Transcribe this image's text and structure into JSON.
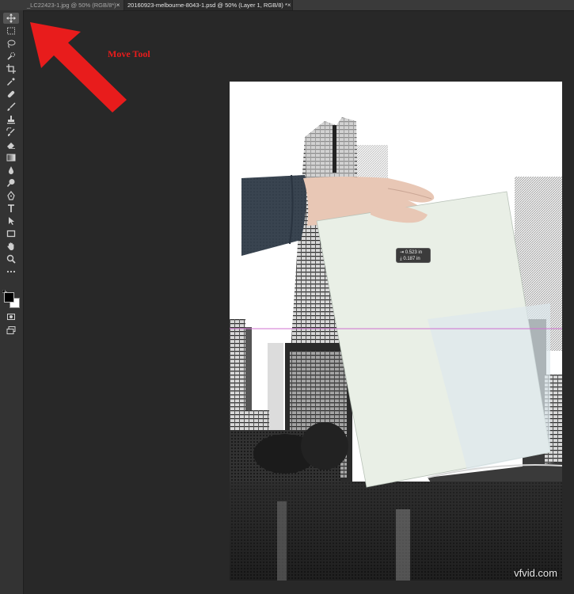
{
  "tabs": [
    {
      "label": "_LC22423-1.jpg @ 50% (RGB/8*)",
      "close": "×"
    },
    {
      "label": "20160923-melbourne-8043-1.psd @ 50% (Layer 1, RGB/8) *",
      "close": "×"
    }
  ],
  "tools": [
    {
      "name": "move-tool",
      "icon": "move-icon",
      "active": true
    },
    {
      "name": "marquee-tool",
      "icon": "marquee-icon"
    },
    {
      "name": "lasso-tool",
      "icon": "lasso-icon"
    },
    {
      "name": "quick-selection-tool",
      "icon": "quick-selection-icon"
    },
    {
      "name": "crop-tool",
      "icon": "crop-icon"
    },
    {
      "name": "eyedropper-tool",
      "icon": "eyedropper-icon"
    },
    {
      "name": "healing-brush-tool",
      "icon": "bandage-icon"
    },
    {
      "name": "brush-tool",
      "icon": "brush-icon"
    },
    {
      "name": "clone-stamp-tool",
      "icon": "stamp-icon"
    },
    {
      "name": "history-brush-tool",
      "icon": "history-brush-icon"
    },
    {
      "name": "eraser-tool",
      "icon": "eraser-icon"
    },
    {
      "name": "gradient-tool",
      "icon": "gradient-icon"
    },
    {
      "name": "blur-tool",
      "icon": "drop-icon"
    },
    {
      "name": "dodge-tool",
      "icon": "dodge-icon"
    },
    {
      "name": "pen-tool",
      "icon": "pen-icon"
    },
    {
      "name": "type-tool",
      "icon": "type-icon"
    },
    {
      "name": "path-selection-tool",
      "icon": "arrow-select-icon"
    },
    {
      "name": "rectangle-tool",
      "icon": "rectangle-icon"
    },
    {
      "name": "hand-tool",
      "icon": "hand-icon"
    },
    {
      "name": "zoom-tool",
      "icon": "zoom-icon"
    },
    {
      "name": "more-tools",
      "icon": "ellipsis-icon"
    }
  ],
  "colors": {
    "foreground": "#000000",
    "background": "#ffffff",
    "annotation": "#e81c1c",
    "guide": "#d070d0"
  },
  "annotation": {
    "label": "Move Tool"
  },
  "readout": {
    "width": "0.523 in",
    "height": "0.187 in"
  },
  "watermark": "vfvid.com"
}
